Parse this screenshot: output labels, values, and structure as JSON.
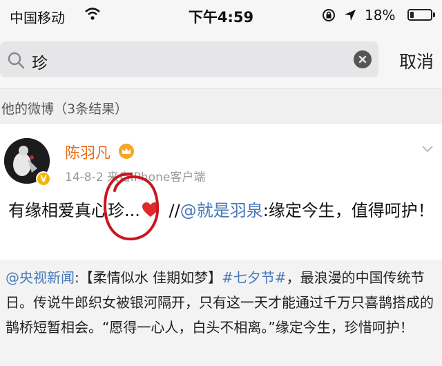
{
  "status_bar": {
    "carrier": "中国移动",
    "time": "下午4:59",
    "battery": "18%",
    "battery_level": 0.18
  },
  "search": {
    "query": "珍",
    "cancel_label": "取消"
  },
  "section": {
    "title": "他的微博（3条结果）"
  },
  "post": {
    "username": "陈羽凡",
    "meta": "14-8-2  来自iPhone客户端",
    "text_start": "有缘相爱真心珍...",
    "text_sep": " //",
    "mention": "@就是羽泉",
    "text_end": ":缘定今生，值得呵护！",
    "repost": {
      "mention": "@央视新闻",
      "part1": ":【柔情似水 佳期如梦】",
      "hashtag": "#七夕节#",
      "part2": "，最浪漫的中国传统节日。传说牛郎织女被银河隔开，只有这一天才能通过千万只喜鹊搭成的鹊桥短暂相会。“愿得一心人，白头不相离。”缘定今生，珍惜呵护！"
    }
  },
  "colors": {
    "username": "#e66c1a",
    "link": "#4778b8",
    "heart": "#e02a2a",
    "circle_mark": "#c8171e"
  }
}
